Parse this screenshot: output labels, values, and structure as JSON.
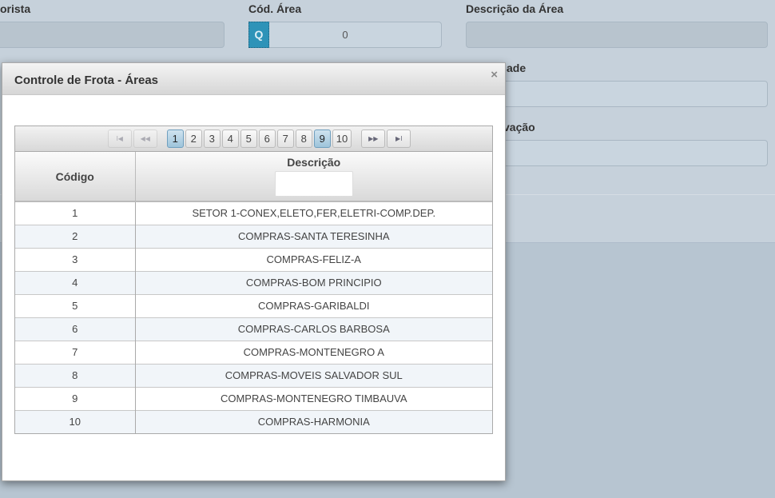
{
  "form": {
    "labels": {
      "motorista": "orista",
      "cod_area": "Cód. Área",
      "descricao_area": "Descrição da Área",
      "unidade": "ade",
      "observacao": "vação"
    },
    "cod_area_value": "0",
    "search_icon": "search-icon"
  },
  "modal": {
    "title": "Controle de Frota - Áreas",
    "close": "×",
    "pager": {
      "first": "I◀",
      "prev": "◀◀",
      "pages": [
        "1",
        "2",
        "3",
        "4",
        "5",
        "6",
        "7",
        "8",
        "9",
        "10"
      ],
      "current": "1",
      "next": "▶▶",
      "last": "▶I"
    },
    "columns": [
      "Código",
      "Descrição"
    ],
    "rows": [
      [
        "1",
        "SETOR 1-CONEX,ELETO,FER,ELETRI-COMP.DEP."
      ],
      [
        "2",
        "COMPRAS-SANTA TERESINHA"
      ],
      [
        "3",
        "COMPRAS-FELIZ-A"
      ],
      [
        "4",
        "COMPRAS-BOM PRINCIPIO"
      ],
      [
        "5",
        "COMPRAS-GARIBALDI"
      ],
      [
        "6",
        "COMPRAS-CARLOS BARBOSA"
      ],
      [
        "7",
        "COMPRAS-MONTENEGRO A"
      ],
      [
        "8",
        "COMPRAS-MOVEIS SALVADOR SUL"
      ],
      [
        "9",
        "COMPRAS-MONTENEGRO TIMBAUVA"
      ],
      [
        "10",
        "COMPRAS-HARMONIA"
      ]
    ]
  }
}
